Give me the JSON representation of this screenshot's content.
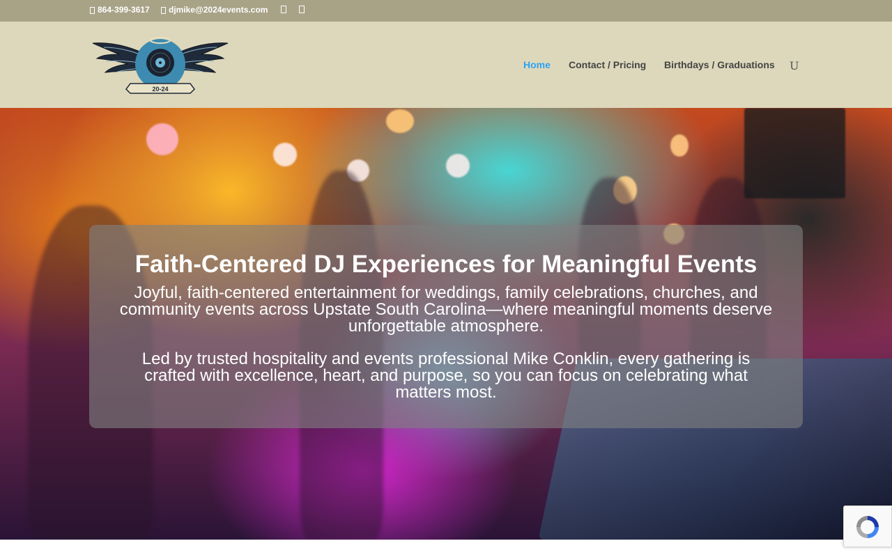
{
  "topbar": {
    "phone": "864-399-3617",
    "email": "djmike@2024events.com",
    "social_icons": [
      "facebook-icon",
      "instagram-icon"
    ]
  },
  "header": {
    "logo_text": "20-24",
    "nav": [
      {
        "label": "Home",
        "active": true
      },
      {
        "label": "Contact / Pricing",
        "active": false
      },
      {
        "label": "Birthdays / Graduations",
        "active": false
      }
    ],
    "search_glyph": "U"
  },
  "hero": {
    "title": "Faith-Centered DJ Experiences for Meaningful Events",
    "paragraph1": "Joyful, faith-centered entertainment for weddings, family celebrations, churches, and community events across Upstate South Carolina—where meaningful moments deserve unforgettable atmosphere.",
    "paragraph2": "Led by trusted hospitality and events professional Mike Conklin, every gathering is crafted with excellence, heart, and purpose, so you can focus on celebrating what matters most."
  },
  "colors": {
    "topbar_bg": "#a8a287",
    "header_bg": "#ddd8bb",
    "nav_active": "#2ea3f2",
    "nav_text": "#444444"
  },
  "widgets": {
    "recaptcha_icon": "recaptcha-icon"
  }
}
